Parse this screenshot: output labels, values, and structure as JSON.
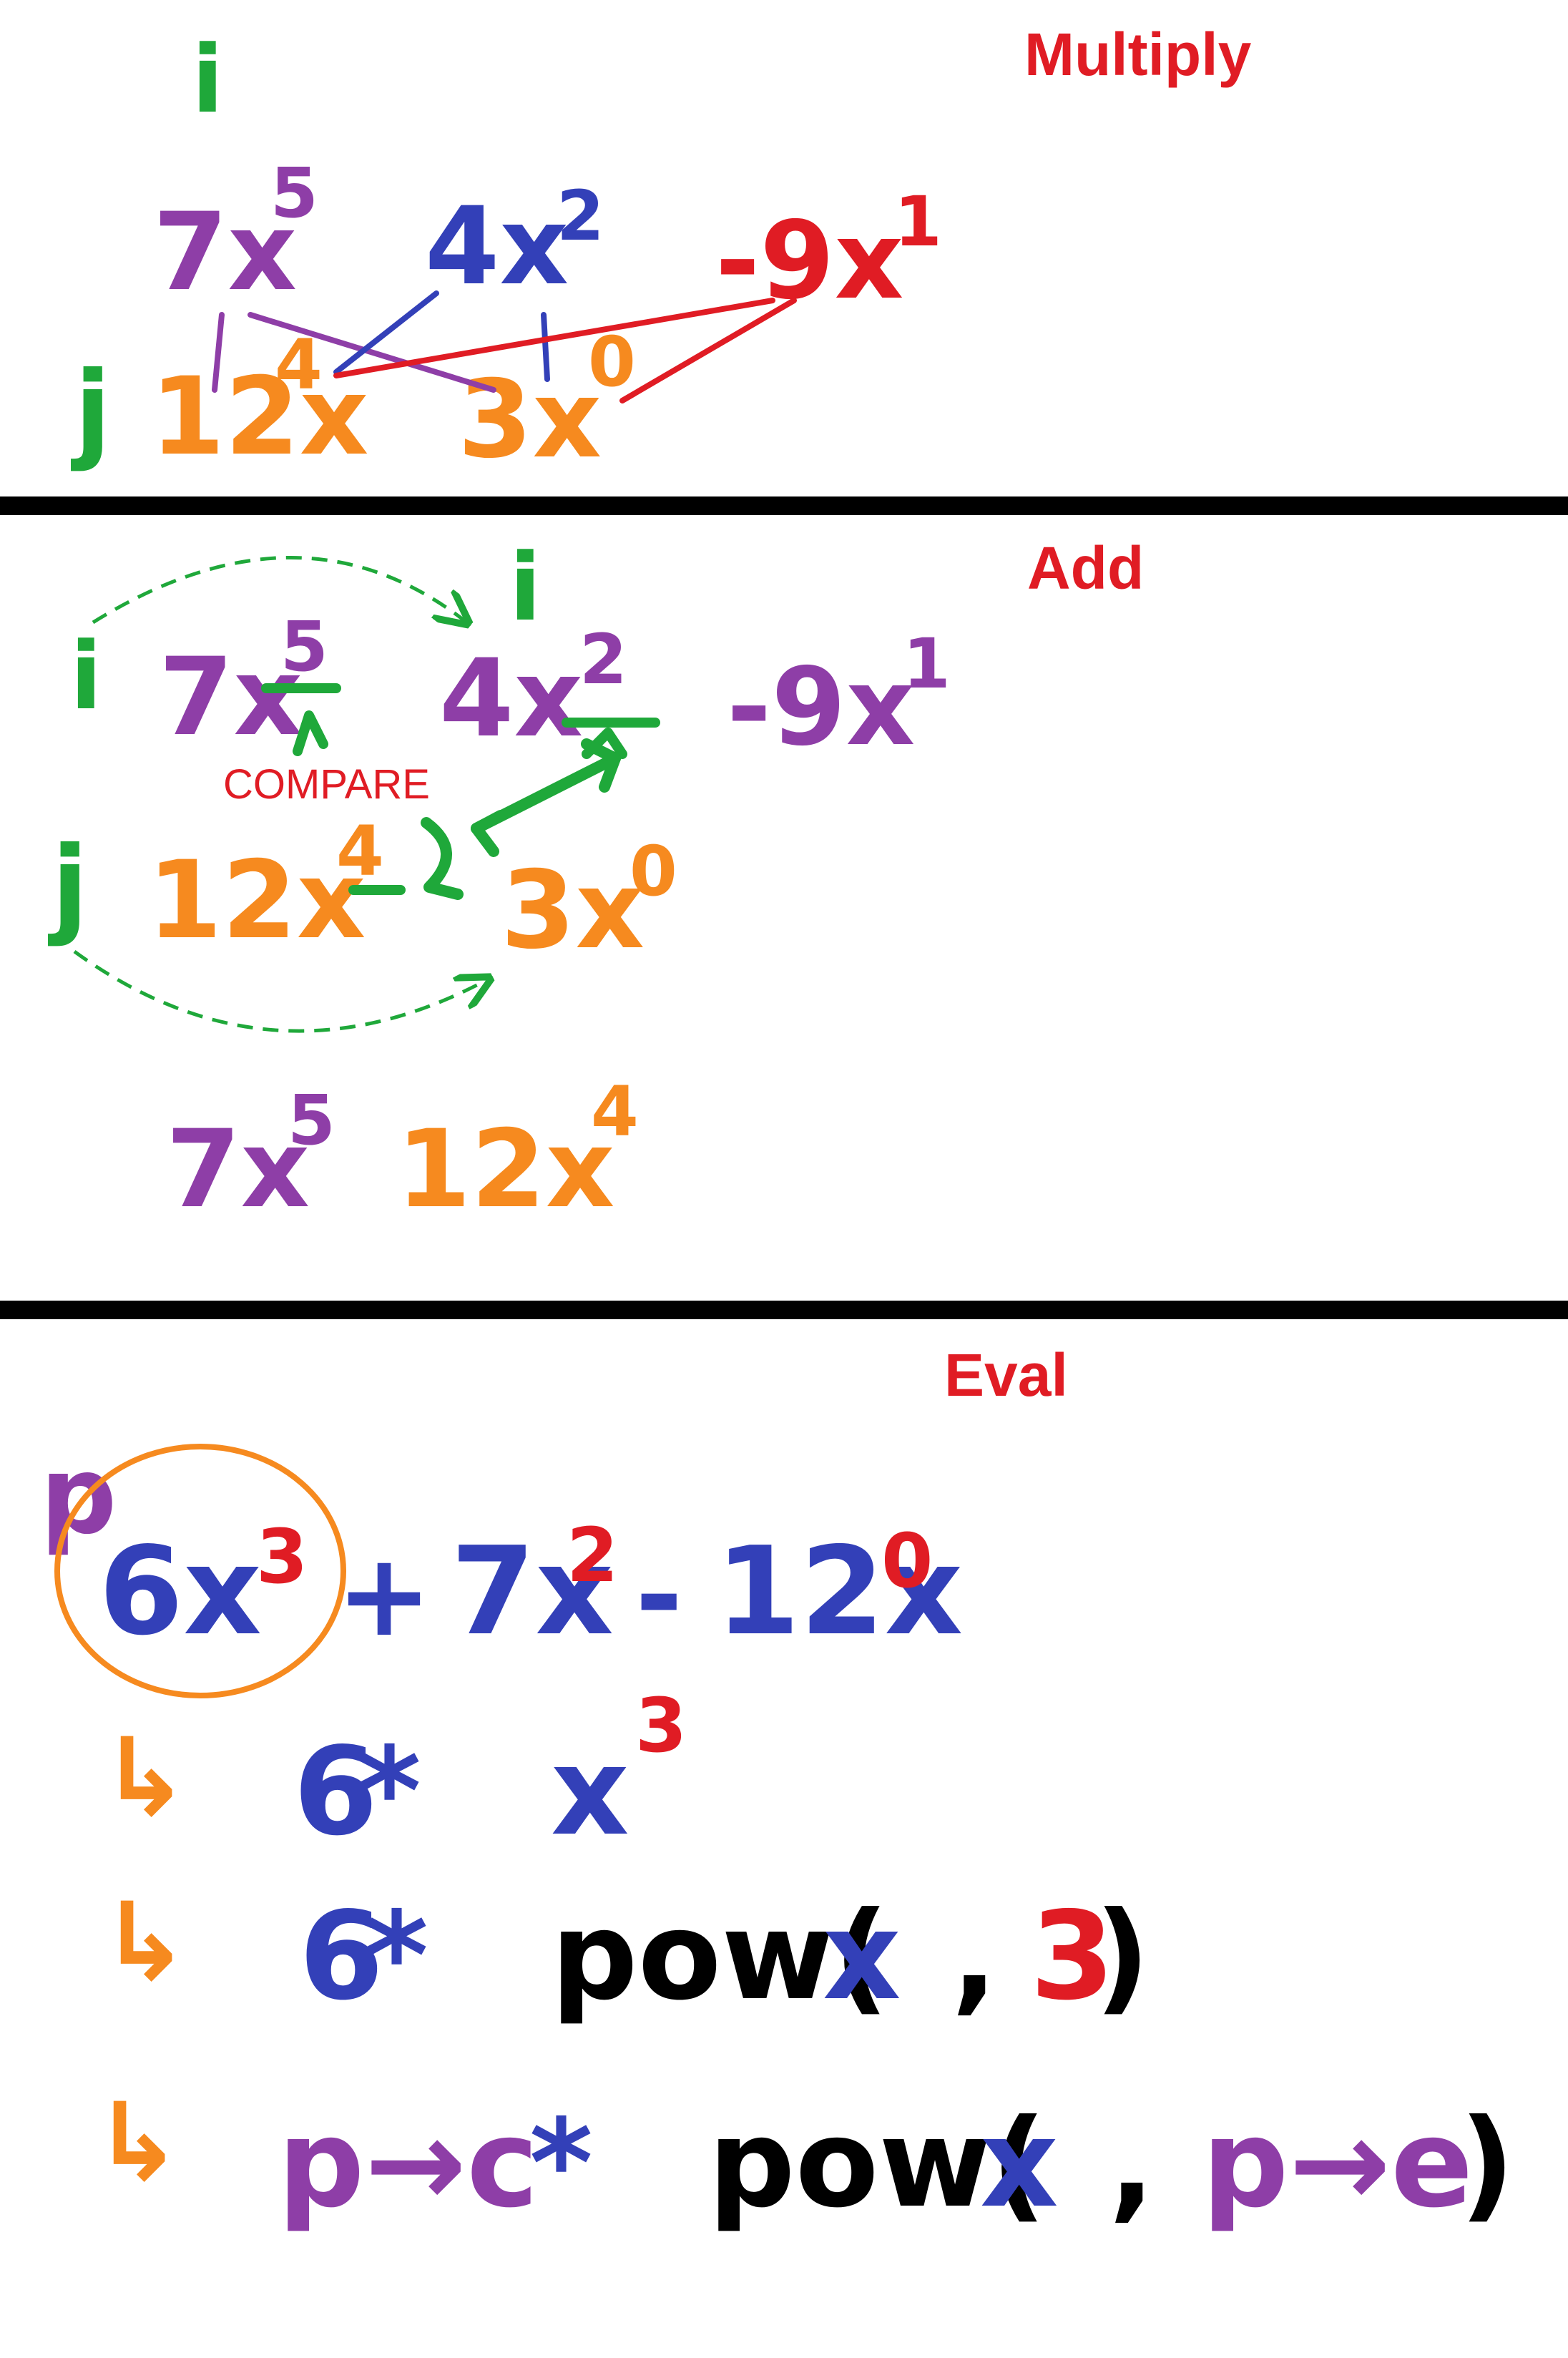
{
  "colors": {
    "red": "#e01c24",
    "green": "#1fa83a",
    "purple": "#8e3ea7",
    "blue": "#3340b8",
    "orange": "#f68a1f",
    "black": "#000000"
  },
  "multiply": {
    "heading": "Multiply",
    "i_label": "i",
    "j_label": "j",
    "top_terms": [
      {
        "coef": "7x",
        "exp": "5"
      },
      {
        "coef": "4x",
        "exp": "2"
      },
      {
        "coef": "-9x",
        "exp": "1"
      }
    ],
    "bottom_terms": [
      {
        "coef": "12x",
        "exp": "4"
      },
      {
        "coef": "3x",
        "exp": "0"
      }
    ]
  },
  "add": {
    "heading": "Add",
    "i_label_left": "i",
    "i_label_top": "i",
    "j_label": "j",
    "compare_label": "COMPARE",
    "top_terms": [
      {
        "coef": "7x",
        "exp": "5"
      },
      {
        "coef": "4x",
        "exp": "2"
      },
      {
        "coef": "-9x",
        "exp": "1"
      }
    ],
    "bottom_terms": [
      {
        "coef": "12x",
        "exp": "4"
      },
      {
        "coef": "3x",
        "exp": "0"
      }
    ],
    "result_terms": [
      {
        "coef": "7x",
        "exp": "5"
      },
      {
        "coef": "12x",
        "exp": "4"
      }
    ]
  },
  "eval": {
    "heading": "Eval",
    "p_label": "p",
    "polynomial": {
      "t1_coef": "6x",
      "t1_exp": "3",
      "op1": "+",
      "t2_coef": "7x",
      "t2_exp": "2",
      "op2": "-",
      "t3_coef": "12x",
      "t3_exp": "0"
    },
    "steps": [
      {
        "arrow": "↳",
        "parts": [
          {
            "text": "6",
            "color": "blue"
          },
          {
            "text": " * ",
            "color": "blue"
          },
          {
            "text": "x",
            "color": "blue"
          }
        ],
        "sup": "3"
      },
      {
        "arrow": "↳",
        "parts": [
          {
            "text": "6",
            "color": "blue"
          },
          {
            "text": " * ",
            "color": "blue"
          },
          {
            "text": "pow(",
            "color": "black"
          },
          {
            "text": " x",
            "color": "blue"
          },
          {
            "text": ", ",
            "color": "black"
          },
          {
            "text": "3",
            "color": "red"
          },
          {
            "text": " )",
            "color": "black"
          }
        ]
      },
      {
        "arrow": "↳",
        "parts": [
          {
            "text": "p→c",
            "color": "purple"
          },
          {
            "text": " * ",
            "color": "blue"
          },
          {
            "text": "pow(",
            "color": "black"
          },
          {
            "text": " x",
            "color": "blue"
          },
          {
            "text": ", ",
            "color": "black"
          },
          {
            "text": "p→e",
            "color": "purple"
          },
          {
            "text": ")",
            "color": "black"
          }
        ]
      }
    ]
  }
}
